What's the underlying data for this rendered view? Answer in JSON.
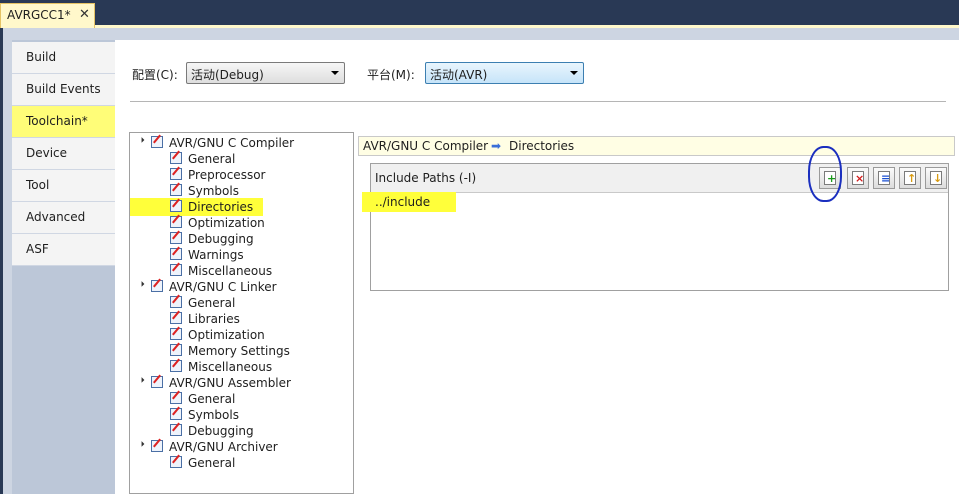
{
  "document_tab": {
    "label": "AVRGCC1*",
    "close": "✕"
  },
  "sidebar": {
    "items": [
      {
        "label": "Build"
      },
      {
        "label": "Build Events"
      },
      {
        "label": "Toolchain*"
      },
      {
        "label": "Device"
      },
      {
        "label": "Tool"
      },
      {
        "label": "Advanced"
      },
      {
        "label": "ASF"
      }
    ],
    "active_index": 2
  },
  "config": {
    "configuration_label": "配置(C):",
    "configuration_value": "活动(Debug)",
    "platform_label": "平台(M):",
    "platform_value": "活动(AVR)"
  },
  "tree": {
    "groups": [
      {
        "label": "AVR/GNU C Compiler",
        "children": [
          "General",
          "Preprocessor",
          "Symbols",
          "Directories",
          "Optimization",
          "Debugging",
          "Warnings",
          "Miscellaneous"
        ]
      },
      {
        "label": "AVR/GNU C Linker",
        "children": [
          "General",
          "Libraries",
          "Optimization",
          "Memory Settings",
          "Miscellaneous"
        ]
      },
      {
        "label": "AVR/GNU Assembler",
        "children": [
          "General",
          "Symbols",
          "Debugging"
        ]
      },
      {
        "label": "AVR/GNU Archiver",
        "children": [
          "General"
        ]
      }
    ],
    "selected": "Directories"
  },
  "breadcrumb": {
    "section": "AVR/GNU C Compiler",
    "arrow": "➡",
    "page": "Directories"
  },
  "include_paths": {
    "title": "Include Paths (-I)",
    "items": [
      "../include"
    ],
    "toolbar": [
      "add-icon",
      "delete-icon",
      "edit-icon",
      "move-up-icon",
      "move-down-icon"
    ]
  },
  "colors": {
    "highlight": "#ffff3a",
    "annotation_circle": "#1b2fbf",
    "tab_bg": "#fff8cb"
  }
}
